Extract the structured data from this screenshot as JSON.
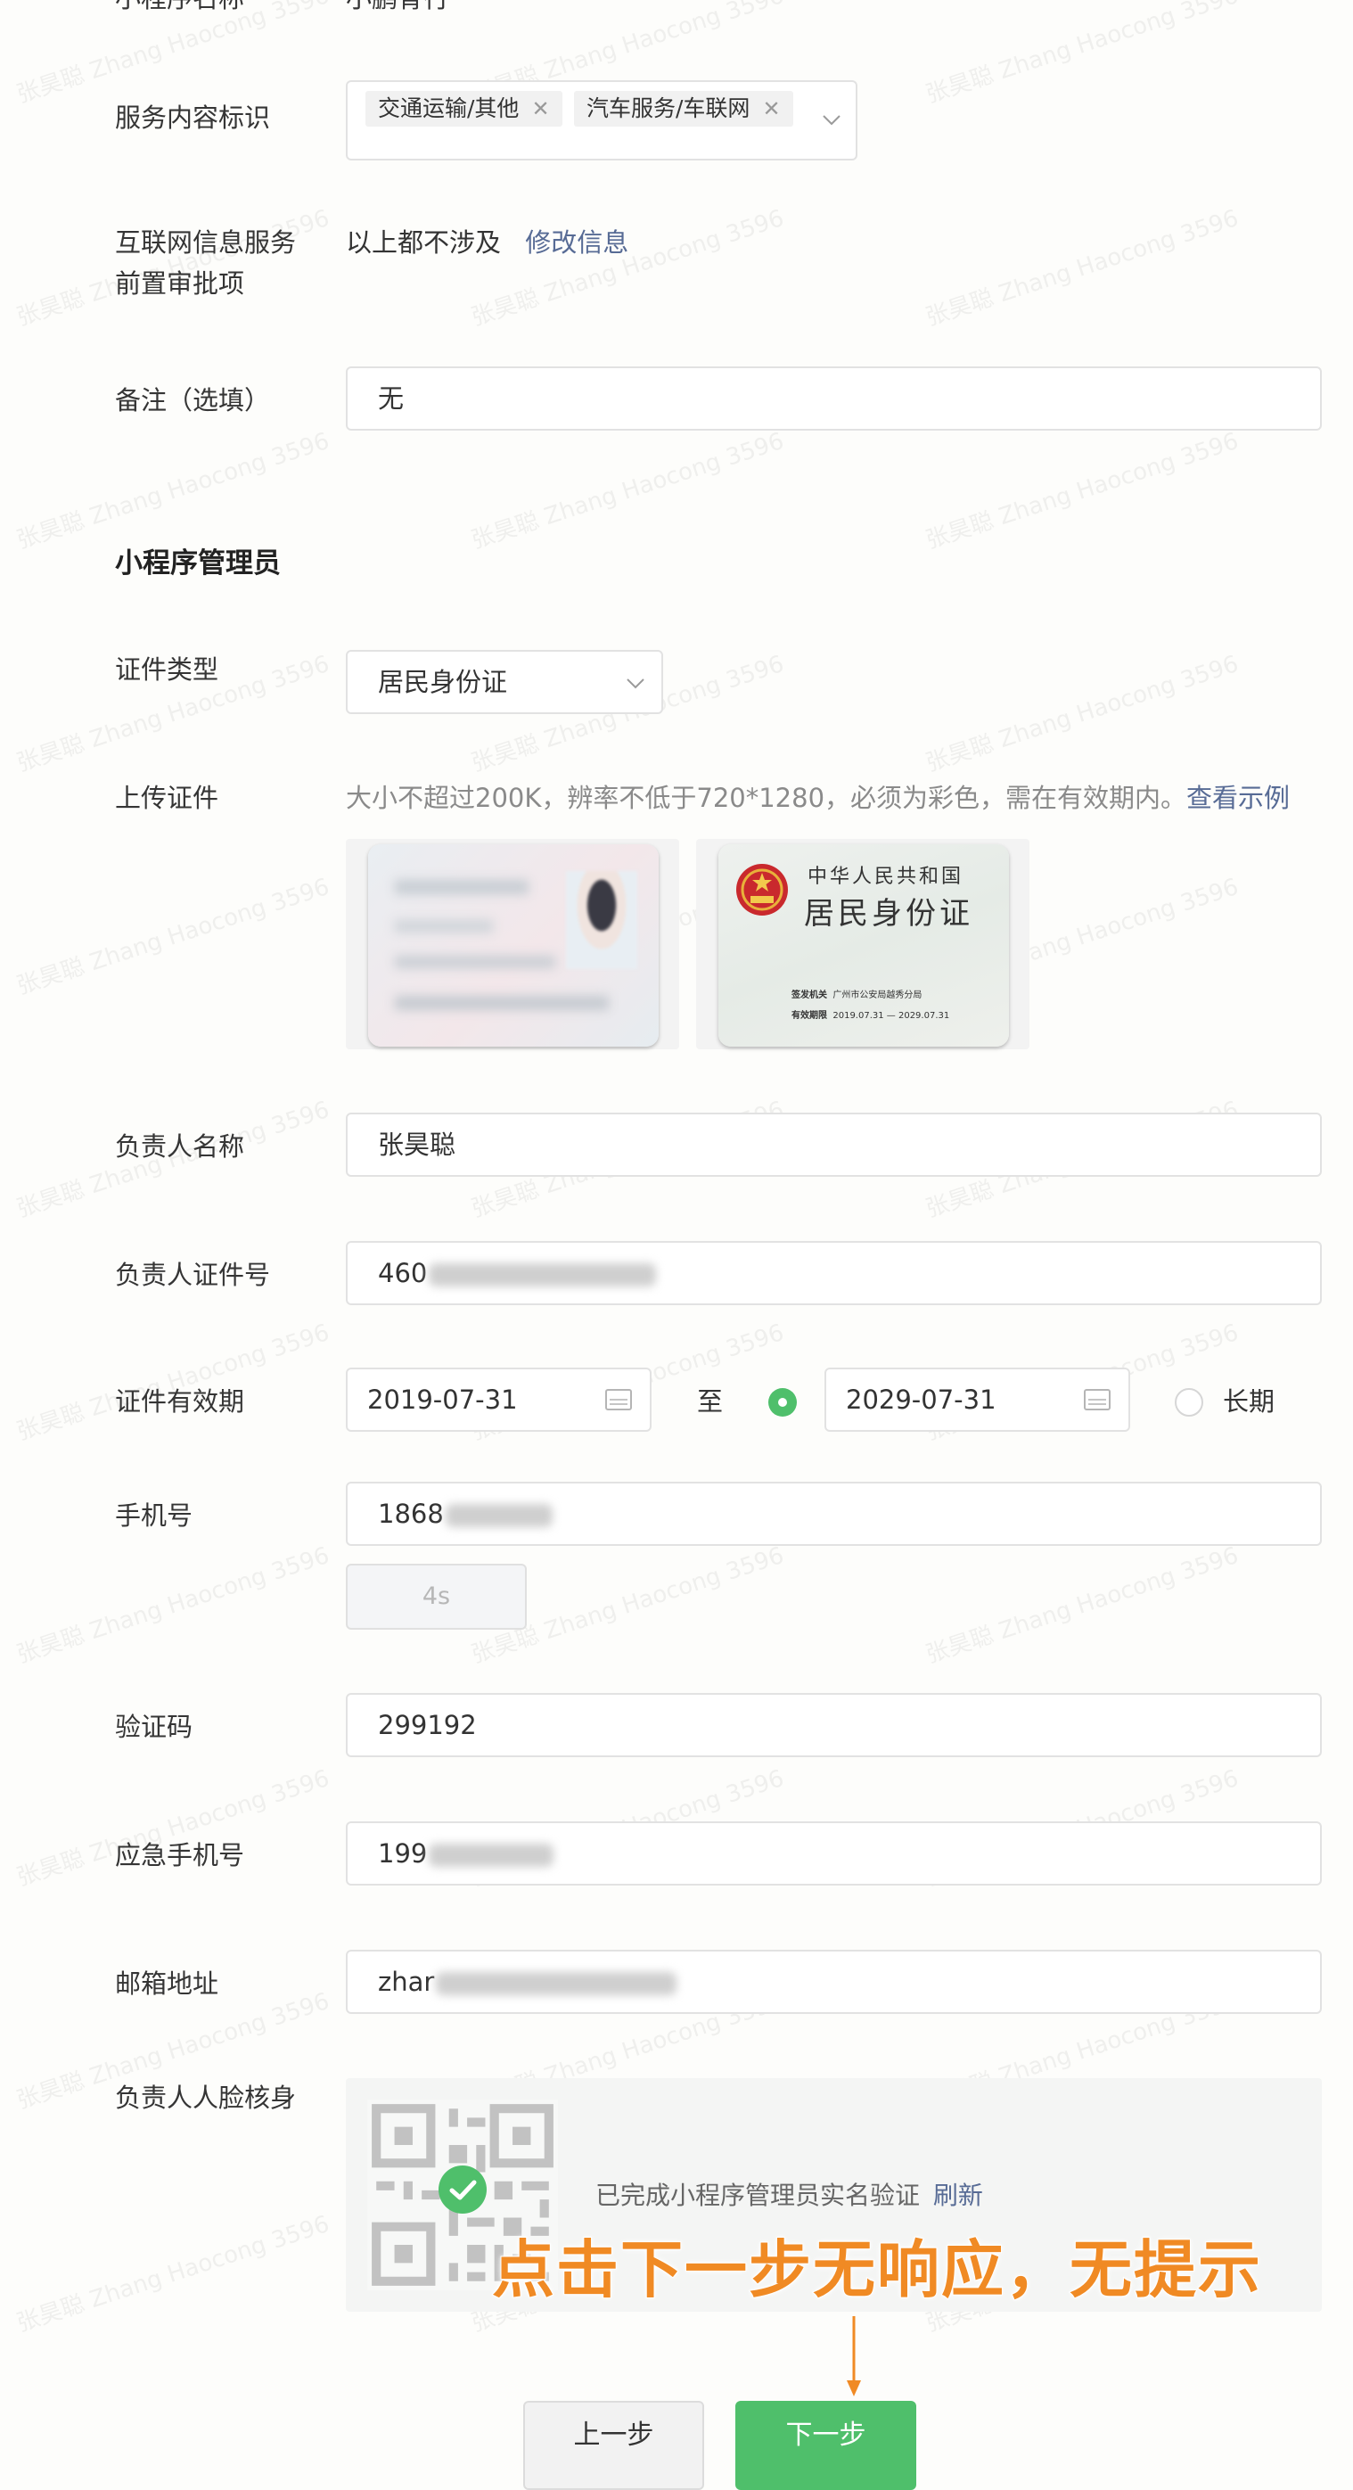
{
  "app_name": {
    "label": "小程序名称",
    "value": "小鹏骨行"
  },
  "service_tags": {
    "label": "服务内容标识",
    "tags": [
      "交通运输/其他",
      "汽车服务/车联网"
    ]
  },
  "approval": {
    "label_line1": "互联网信息服务",
    "label_line2": "前置审批项",
    "value": "以上都不涉及",
    "link": "修改信息"
  },
  "remark": {
    "label": "备注（选填）",
    "value": "无"
  },
  "admin_section": {
    "title": "小程序管理员"
  },
  "id_type": {
    "label": "证件类型",
    "value": "居民身份证"
  },
  "upload": {
    "label": "上传证件",
    "hint": "大小不超过200K，辨率不低于720*1280，必须为彩色，需在有效期内。",
    "link": "查看示例"
  },
  "id_back": {
    "line1": "中华人民共和国",
    "line2": "居民身份证",
    "authority_label": "签发机关",
    "authority": "广州市公安局越秀分局",
    "validity_label": "有效期限",
    "validity": "2019.07.31 — 2029.07.31"
  },
  "owner_name": {
    "label": "负责人名称",
    "value": "张昊聪"
  },
  "owner_id": {
    "label": "负责人证件号",
    "value": "460"
  },
  "validity": {
    "label": "证件有效期",
    "start": "2019-07-31",
    "to": "至",
    "end": "2029-07-31",
    "long_term": "长期",
    "selected": "end"
  },
  "phone": {
    "label": "手机号",
    "value": "1868",
    "countdown": "4s"
  },
  "code": {
    "label": "验证码",
    "value": "299192"
  },
  "emergency_phone": {
    "label": "应急手机号",
    "value": "199"
  },
  "email": {
    "label": "邮箱地址",
    "value": "zhar"
  },
  "face_verify": {
    "label": "负责人人脸核身",
    "status": "已完成小程序管理员实名验证",
    "refresh": "刷新"
  },
  "annotation": {
    "text": "点击下一步无响应，无提示",
    "color": "#f08a24"
  },
  "buttons": {
    "prev": "上一步",
    "next": "下一步"
  },
  "watermark": "张昊聪 Zhang Haocong 3596",
  "colors": {
    "accent_green": "#4fbf6b",
    "link": "#576b95",
    "annotation": "#f08a24"
  }
}
